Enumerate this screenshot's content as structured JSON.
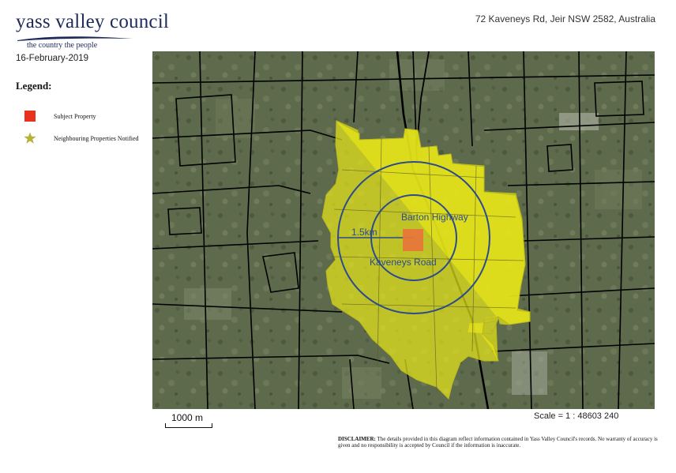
{
  "header": {
    "logo_text": "yass valley council",
    "logo_tagline": "the country   the people",
    "address": "72 Kaveneys Rd, Jeir NSW 2582, Australia",
    "date": "16-February-2019"
  },
  "legend": {
    "title": "Legend:",
    "items": [
      {
        "label": "Subject Property",
        "symbol": "square",
        "color": "#e8321e"
      },
      {
        "label": "Neighbouring Properties Notified",
        "symbol": "star",
        "color": "#b5b33a"
      }
    ]
  },
  "map": {
    "labels": {
      "radius": "1.5km",
      "highway": "Barton Highway",
      "road": "Kaveneys Road"
    },
    "colors": {
      "notified_area": "#e6e619",
      "subject_property": "#e8753a",
      "buffer_rings": "#2c4a8e",
      "cadastre_lines": "#000000",
      "imagery": "#5f6a4d"
    }
  },
  "footer": {
    "scale_bar": "1000 m",
    "scale_ratio": "Scale = 1 : 48603 240",
    "disclaimer_lead": "DISCLAIMER:",
    "disclaimer_text": " The details provided in this diagram reflect information contained in Yass Valley Council's records. No warranty of accuracy is given and no responsibility is accepted by Council if the information is inaccurate."
  }
}
